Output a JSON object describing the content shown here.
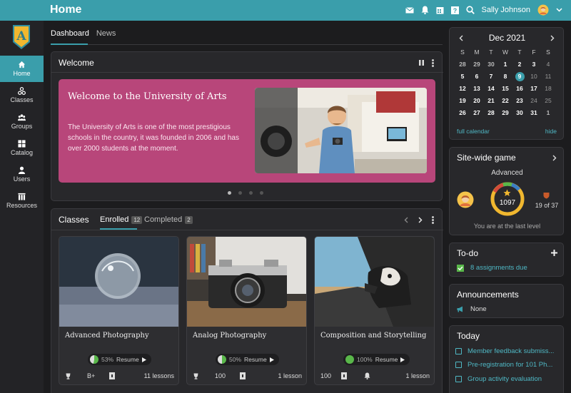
{
  "header": {
    "title": "Home",
    "user_name": "Sally Johnson"
  },
  "sidebar": {
    "items": [
      {
        "label": "Home",
        "icon": "home-icon"
      },
      {
        "label": "Classes",
        "icon": "classes-icon"
      },
      {
        "label": "Groups",
        "icon": "groups-icon"
      },
      {
        "label": "Catalog",
        "icon": "catalog-icon"
      },
      {
        "label": "Users",
        "icon": "user-icon"
      },
      {
        "label": "Resources",
        "icon": "resources-icon"
      }
    ]
  },
  "tabs": {
    "dashboard": "Dashboard",
    "news": "News"
  },
  "welcome": {
    "heading": "Welcome",
    "title": "Welcome to the University of Arts",
    "text": "The University of Arts is one of the most prestigious schools in the country, it was founded in 2006 and has over 2000 students at the moment."
  },
  "classes": {
    "heading": "Classes",
    "enrolled_label": "Enrolled",
    "enrolled_count": "12",
    "completed_label": "Completed",
    "completed_count": "2",
    "resume_label": "Resume",
    "items": [
      {
        "name": "Advanced Photography",
        "progress": "53%",
        "progress_value": 53,
        "grade": "B+",
        "lessons": "11 lessons"
      },
      {
        "name": "Analog Photography",
        "progress": "50%",
        "progress_value": 50,
        "grade": "100",
        "lessons": "1 lesson"
      },
      {
        "name": "Composition and Storytelling",
        "progress": "100%",
        "progress_value": 100,
        "grade": "100",
        "lessons": "1 lesson"
      }
    ]
  },
  "calendar": {
    "month": "Dec 2021",
    "weekdays": [
      "S",
      "M",
      "T",
      "W",
      "T",
      "F",
      "S"
    ],
    "days": [
      [
        "28",
        "29",
        "30",
        "1",
        "2",
        "3",
        "4"
      ],
      [
        "5",
        "6",
        "7",
        "8",
        "9",
        "10",
        "11"
      ],
      [
        "12",
        "13",
        "14",
        "15",
        "16",
        "17",
        "18"
      ],
      [
        "19",
        "20",
        "21",
        "22",
        "23",
        "24",
        "25"
      ],
      [
        "26",
        "27",
        "28",
        "29",
        "30",
        "31",
        "1"
      ]
    ],
    "full_link": "full calendar",
    "hide_link": "hide"
  },
  "game": {
    "heading": "Site-wide game",
    "level": "Advanced",
    "points": "1097",
    "rank": "19 of 37",
    "note": "You are at the last level"
  },
  "todo": {
    "heading": "To-do",
    "item": "8 assignments due"
  },
  "announcements": {
    "heading": "Announcements",
    "item": "None"
  },
  "today": {
    "heading": "Today",
    "items": [
      "Member feedback submiss...",
      "Pre-registration for 101 Ph...",
      "Group activity evaluation"
    ]
  },
  "colors": {
    "accent": "#3a9eab",
    "hero": "#b8467a",
    "progress": "#59b74a"
  }
}
